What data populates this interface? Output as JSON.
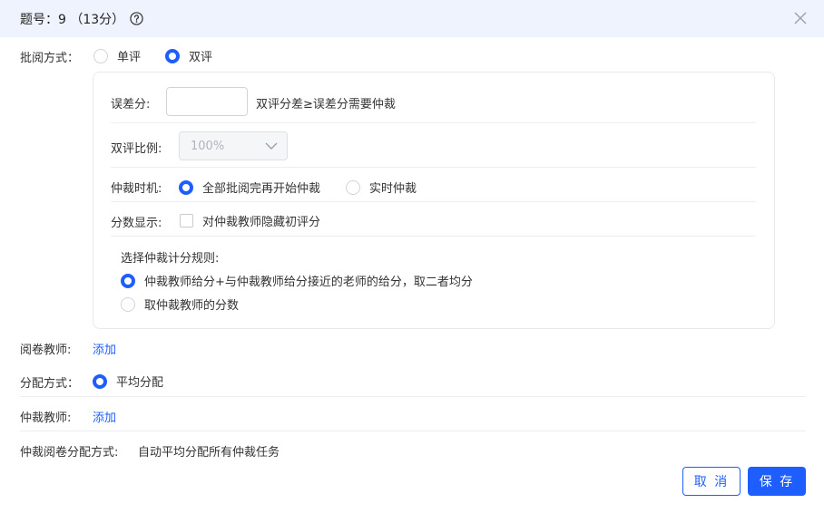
{
  "header": {
    "title": "题号：9 （13分）",
    "help_icon": "question-circle-icon",
    "close_icon": "close-icon"
  },
  "grading_mode": {
    "label": "批阅方式：",
    "options": [
      {
        "label": "单评",
        "selected": false
      },
      {
        "label": "双评",
        "selected": true
      }
    ]
  },
  "panel": {
    "error_score": {
      "label": "误差分:",
      "value": "",
      "hint": "双评分差≥误差分需要仲裁"
    },
    "double_ratio": {
      "label": "双评比例:",
      "value": "100%",
      "disabled": true
    },
    "arbitration_timing": {
      "label": "仲裁时机:",
      "options": [
        {
          "label": "全部批阅完再开始仲裁",
          "selected": true
        },
        {
          "label": "实时仲裁",
          "selected": false
        }
      ]
    },
    "score_display": {
      "label": "分数显示:",
      "checkbox_label": "对仲裁教师隐藏初评分",
      "checked": false
    },
    "scoring_rule": {
      "title": "选择仲裁计分规则:",
      "options": [
        {
          "label": "仲裁教师给分+与仲裁教师给分接近的老师的给分，取二者均分",
          "selected": true
        },
        {
          "label": "取仲裁教师的分数",
          "selected": false
        }
      ]
    }
  },
  "graders": {
    "label": "阅卷教师:",
    "link": "添加"
  },
  "distribution": {
    "label": "分配方式：",
    "option": "平均分配",
    "selected": true
  },
  "arbitrators": {
    "label": "仲裁教师:",
    "link": "添加"
  },
  "arbitration_distribution": {
    "label": "仲裁阅卷分配方式:",
    "value": "自动平均分配所有仲裁任务"
  },
  "footer": {
    "cancel_label": "取 消",
    "save_label": "保 存"
  },
  "colors": {
    "accent": "#1e5eff",
    "header_bg": "#eef3fd"
  }
}
